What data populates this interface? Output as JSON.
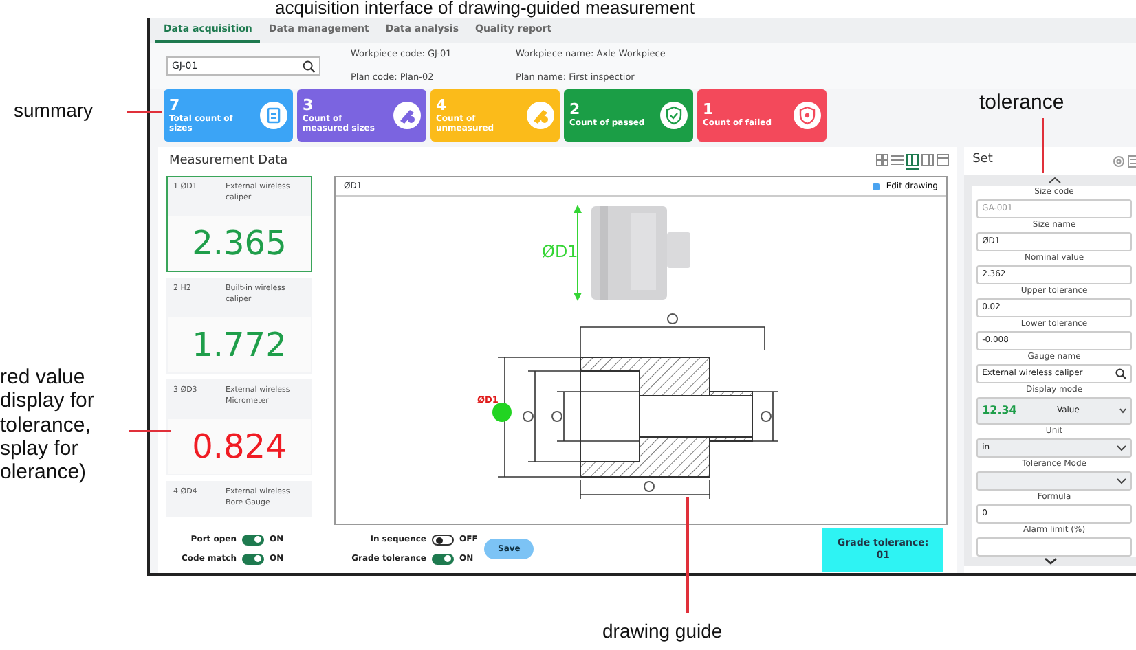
{
  "figure": {
    "caption": "acquisition interface of drawing-guided measurement",
    "annotations": [
      {
        "kind": "summary",
        "lines": [
          "summary"
        ]
      },
      {
        "kind": "tolerance",
        "lines": [
          "tolerance"
        ]
      },
      {
        "kind": "value",
        "lines": [
          "red value",
          "display for",
          "tolerance,",
          "splay for",
          "olerance)"
        ]
      },
      {
        "kind": "guide",
        "lines": [
          "drawing guide"
        ]
      }
    ]
  },
  "tabs": [
    {
      "label": "Data acquisition",
      "selected": true
    },
    {
      "label": "Data management",
      "selected": false
    },
    {
      "label": "Data analysis",
      "selected": false
    },
    {
      "label": "Quality report",
      "selected": false
    }
  ],
  "search": {
    "value": "GJ-01"
  },
  "info": [
    "Workpiece code:  GJ-01",
    "Workpiece name: Axle  Workpiece",
    "Plan code: Plan-02",
    "Plan name: First inspectior"
  ],
  "summary_cards": [
    {
      "kind": "total",
      "count": "7",
      "label": "Total count of sizes",
      "color": "#3ba4f6"
    },
    {
      "kind": "measured",
      "count": "3",
      "label": "Count of measured sizes",
      "color": "#7b64e0"
    },
    {
      "kind": "unmeasured",
      "count": "4",
      "label": "Count of unmeasured",
      "color": "#fbbb1a"
    },
    {
      "kind": "passed",
      "count": "2",
      "label": "Count of passed",
      "color": "#1b9e46"
    },
    {
      "kind": "failed",
      "count": "1",
      "label": "Count of failed",
      "color": "#f3495b"
    }
  ],
  "measurement": {
    "title": "Measurement Data",
    "views": [
      {
        "selected": false
      },
      {
        "selected": false
      },
      {
        "selected": true
      },
      {
        "selected": false
      },
      {
        "selected": false
      }
    ],
    "items": [
      {
        "index": "1",
        "name": "ØD1",
        "gauge": "External wireless caliper",
        "value": "2.365",
        "in_tolerance": true,
        "selected": true
      },
      {
        "index": "2",
        "name": "H2",
        "gauge": "Built-in wireless caliper",
        "value": "1.772",
        "in_tolerance": true,
        "selected": false
      },
      {
        "index": "3",
        "name": "ØD3",
        "gauge": "External wireless Micrometer",
        "value": "0.824",
        "in_tolerance": false,
        "selected": false
      },
      {
        "index": "4",
        "name": "ØD4",
        "gauge": "External wireless Bore Gauge",
        "selected": false
      }
    ]
  },
  "drawing": {
    "title": "ØD1",
    "edit_label": "Edit drawing",
    "part_label": "ØD1",
    "marker_label": "ØD1"
  },
  "bottom_bar": {
    "toggles": [
      {
        "label": "Port open",
        "on": true,
        "state_text": "ON"
      },
      {
        "label": "In sequence",
        "on": false,
        "state_text": "OFF"
      },
      {
        "label": "Code match",
        "on": true,
        "state_text": "ON"
      },
      {
        "label": "Grade tolerance",
        "on": true,
        "state_text": "ON"
      }
    ],
    "save_label": "Save",
    "grade": [
      "Grade tolerance:",
      "01"
    ]
  },
  "set_panel": {
    "title": "Set",
    "fields": [
      {
        "kind": "input",
        "label": "Size code",
        "value": "GA-001",
        "disabled": true
      },
      {
        "kind": "input",
        "label": "Size name",
        "value": "ØD1"
      },
      {
        "kind": "input",
        "label": "Nominal value",
        "value": "2.362"
      },
      {
        "kind": "input",
        "label": "Upper tolerance",
        "value": "0.02"
      },
      {
        "kind": "input",
        "label": "Lower tolerance",
        "value": "-0.008"
      },
      {
        "kind": "search",
        "label": "Gauge name",
        "value": "External wireless caliper"
      },
      {
        "kind": "display",
        "label": "Display mode",
        "sample": "12.34",
        "value": "Value"
      },
      {
        "kind": "select",
        "label": "Unit",
        "value": "in"
      },
      {
        "kind": "select",
        "label": "Tolerance Mode"
      },
      {
        "kind": "input",
        "label": "Formula",
        "value": "0"
      },
      {
        "kind": "stub",
        "label": "Alarm limit (%)"
      }
    ]
  }
}
